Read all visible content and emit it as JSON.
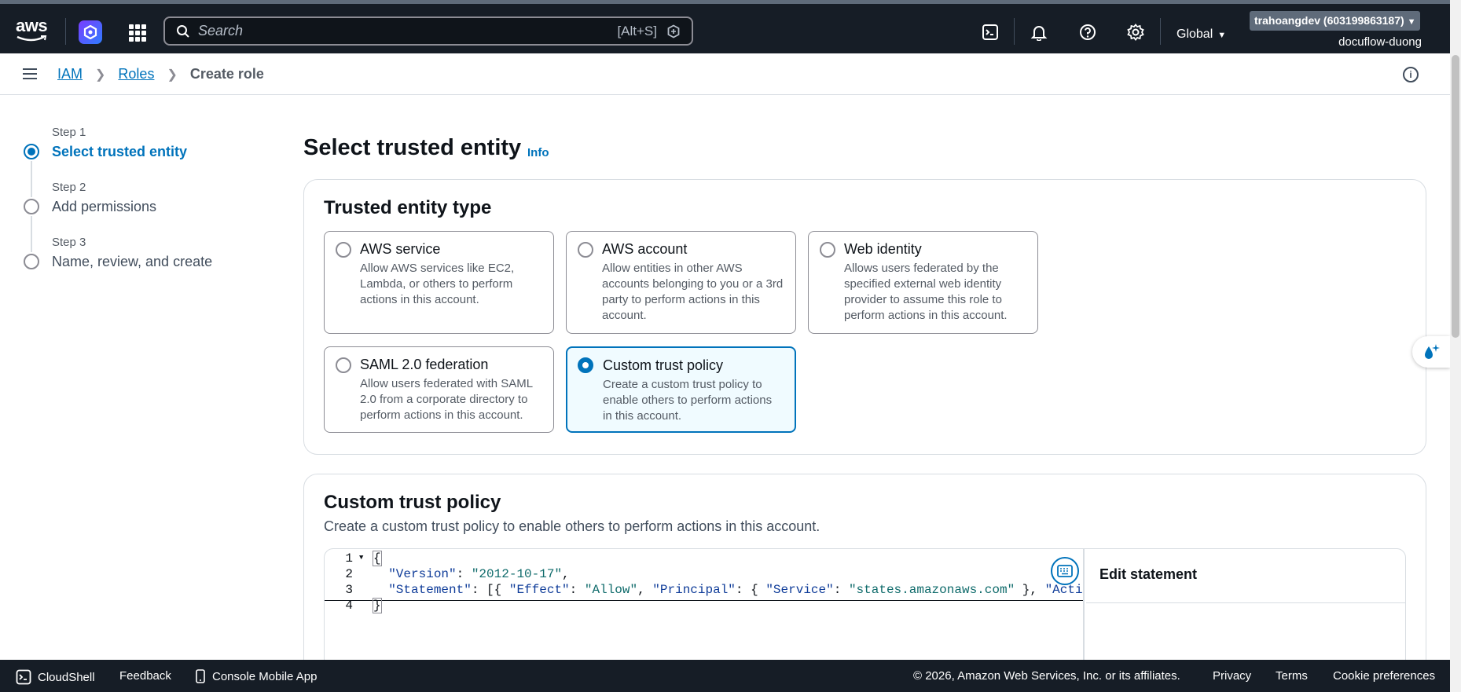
{
  "topnav": {
    "logo_text": "aws",
    "search_placeholder": "Search",
    "search_shortcut": "[Alt+S]",
    "region": "Global",
    "account_label": "trahoangdev (603199863187)",
    "account_alias": "docuflow-duong",
    "icons": [
      "cloudshell-icon",
      "bell-icon",
      "help-icon",
      "gear-icon"
    ]
  },
  "breadcrumb": {
    "items": [
      "IAM",
      "Roles"
    ],
    "current": "Create role"
  },
  "steps": [
    {
      "step": "Step 1",
      "label": "Select trusted entity",
      "state": "active"
    },
    {
      "step": "Step 2",
      "label": "Add permissions",
      "state": "pending"
    },
    {
      "step": "Step 3",
      "label": "Name, review, and create",
      "state": "pending"
    }
  ],
  "page": {
    "title": "Select trusted entity",
    "info": "Info"
  },
  "trusted_entity": {
    "heading": "Trusted entity type",
    "options": [
      {
        "title": "AWS service",
        "desc": "Allow AWS services like EC2, Lambda, or others to perform actions in this account.",
        "selected": false
      },
      {
        "title": "AWS account",
        "desc": "Allow entities in other AWS accounts belonging to you or a 3rd party to perform actions in this account.",
        "selected": false
      },
      {
        "title": "Web identity",
        "desc": "Allows users federated by the specified external web identity provider to assume this role to perform actions in this account.",
        "selected": false
      },
      {
        "title": "SAML 2.0 federation",
        "desc": "Allow users federated with SAML 2.0 from a corporate directory to perform actions in this account.",
        "selected": false
      },
      {
        "title": "Custom trust policy",
        "desc": "Create a custom trust policy to enable others to perform actions in this account.",
        "selected": true
      }
    ]
  },
  "custom_policy": {
    "heading": "Custom trust policy",
    "description": "Create a custom trust policy to enable others to perform actions in this account.",
    "code_lines": [
      "1",
      "2",
      "3",
      "4"
    ],
    "code": {
      "open": "{",
      "version_key": "\"Version\"",
      "version_val": "\"2012-10-17\"",
      "statement_key": "\"Statement\"",
      "effect_key": "\"Effect\"",
      "effect_val": "\"Allow\"",
      "principal_key": "\"Principal\"",
      "service_key": "\"Service\"",
      "service_val": "\"states.amazonaws.com\"",
      "action_key_partial": "\"Acti",
      "close": "}"
    },
    "edit_statement": "Edit statement"
  },
  "footer": {
    "cloudshell": "CloudShell",
    "feedback": "Feedback",
    "mobile_app": "Console Mobile App",
    "copyright": "© 2026, Amazon Web Services, Inc. or its affiliates.",
    "privacy": "Privacy",
    "terms": "Terms",
    "cookies": "Cookie preferences"
  },
  "colors": {
    "nav_bg": "#161d26",
    "accent": "#0073bb",
    "selected_bg": "#f0fbff"
  }
}
